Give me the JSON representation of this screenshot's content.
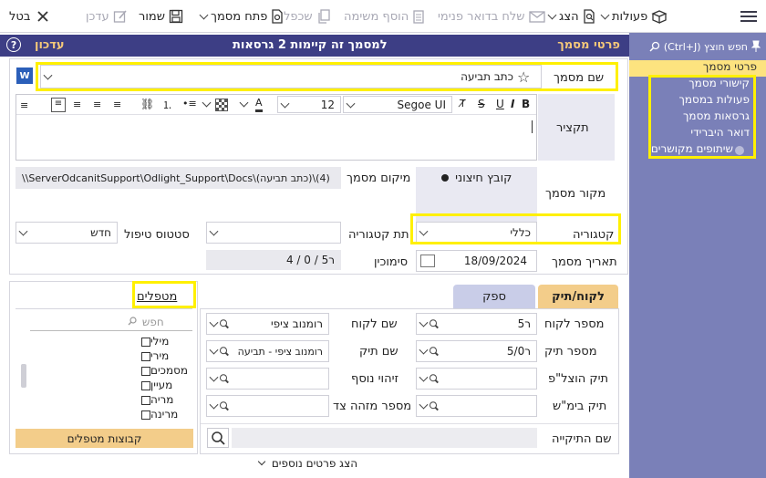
{
  "toolbar": {
    "actions": "פעולות",
    "show": "הצג",
    "send_internal_mail": "שלח בדואר פנימי",
    "add_task": "הוסף משימה",
    "duplicate": "שכפל",
    "open_document": "פתח מסמך",
    "save": "שמור",
    "update": "עדכן",
    "cancel": "בטל"
  },
  "sidebar": {
    "search_placeholder": "חפש חוצץ (Ctrl+J)",
    "items": [
      "פרטי מסמך",
      "קישורי מסמך",
      "פעולות במסמך",
      "גרסאות מסמך",
      "דואר היברידי",
      "שיתופים מקושרים"
    ]
  },
  "header": {
    "title": "פרטי מסמך",
    "subtitle": "למסמך זה קיימות 2 גרסאות",
    "mode": "עדכון"
  },
  "form": {
    "doc_name_label": "שם מסמך",
    "doc_name_value": "כתב תביעה",
    "summary_label": "תקציר",
    "font_name": "Segoe UI",
    "font_size": "12",
    "source_label": "מקור מסמך",
    "source_value": "קובץ חיצוני",
    "location_label": "מיקום מסמך",
    "location_value": "\\\\ServerOdcanitSupport\\Odlight_Support\\Docs\\(כתב תביעה)\\(4)",
    "category_label": "קטגוריה",
    "category_value": "כללי",
    "subcategory_label": "תת קטגוריה",
    "status_label": "סטטוס טיפול",
    "status_value": "חדש",
    "date_label": "תאריך מסמך",
    "date_value": "18/09/2024",
    "mark_label": "סימוכין",
    "mark_value": "ר5 / 0 / 4"
  },
  "tabs": [
    "לקוח/תיק",
    "ספק"
  ],
  "client": {
    "client_no_label": "מספר לקוח",
    "client_no_value": "ר5",
    "client_name_label": "שם לקוח",
    "client_name_value": "רומנוב ציפי",
    "case_no_label": "מספר תיק",
    "case_no_value": "ר5/0",
    "case_name_label": "שם תיק",
    "case_name_value": "רומנוב ציפי - תביעה",
    "exec_case_label": "תיק הוצל\"פ",
    "extra_id_label": "זיהוי נוסף",
    "court_case_label": "תיק בימ\"ש",
    "party_id_label": "מספר מזהה צד",
    "folder_name_label": "שם התיקייה"
  },
  "handlers": {
    "title": "מטפלים",
    "search_placeholder": "חפש",
    "list": [
      "מילי",
      "מירי",
      "מסמכים",
      "מעיין",
      "מריה",
      "מרינה"
    ],
    "groups_button": "קבוצות מטפלים"
  },
  "more_details": "הצג פרטים נוספים"
}
